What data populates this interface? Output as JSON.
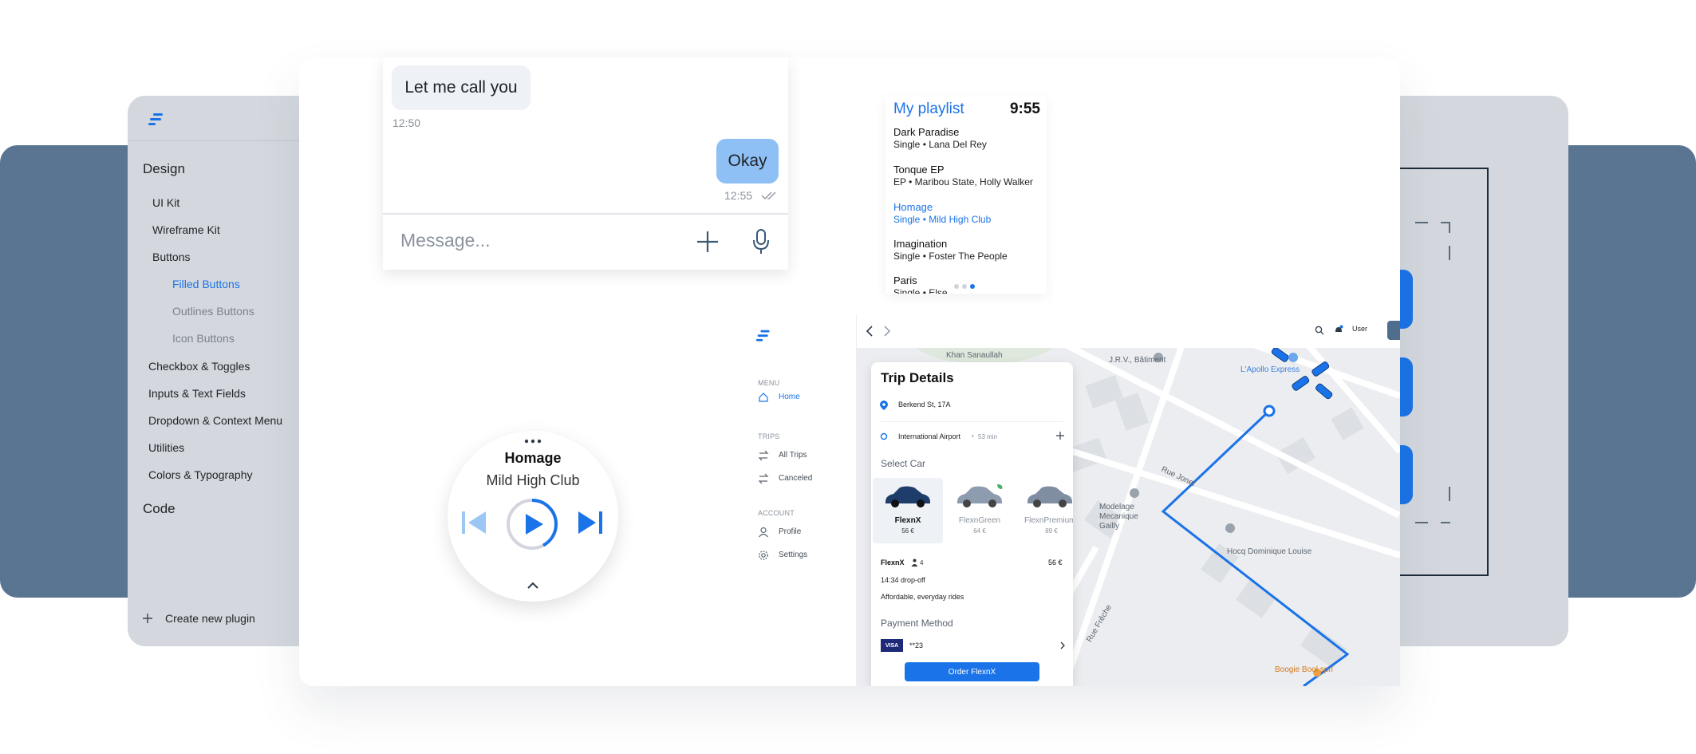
{
  "colors": {
    "accent": "#1a73e8",
    "backdrop_dark": "#5a7592",
    "backdrop_light": "#d4d8de",
    "bubble_outgoing": "#8ec0f5",
    "bubble_incoming": "#eef1f5"
  },
  "sidebar": {
    "sections": [
      {
        "label": "Design"
      },
      {
        "label": "Code"
      }
    ],
    "items": [
      {
        "label": "UI Kit"
      },
      {
        "label": "Wireframe Kit"
      },
      {
        "label": "Buttons"
      },
      {
        "label": "Filled Buttons",
        "active": true
      },
      {
        "label": "Outlines Buttons"
      },
      {
        "label": "Icon Buttons"
      },
      {
        "label": "Checkbox & Toggles"
      },
      {
        "label": "Inputs & Text Fields"
      },
      {
        "label": "Dropdown & Context Menu"
      },
      {
        "label": "Utilities"
      },
      {
        "label": "Colors & Typography"
      }
    ],
    "create_plugin": "Create new plugin"
  },
  "chat": {
    "incoming": {
      "text": "Let me call you",
      "time": "12:50"
    },
    "outgoing": {
      "text": "Okay",
      "time": "12:55"
    },
    "input_placeholder": "Message..."
  },
  "playlist": {
    "title": "My playlist",
    "clock": "9:55",
    "tracks": [
      {
        "name": "Dark Paradise",
        "meta": "Single • Lana Del Rey"
      },
      {
        "name": "Tonque EP",
        "meta": "EP • Maribou State, Holly Walker"
      },
      {
        "name": "Homage",
        "meta": "Single • Mild High Club",
        "highlighted": true
      },
      {
        "name": "Imagination",
        "meta": "Single • Foster The People"
      },
      {
        "name": "Paris",
        "meta": "Single • Else"
      }
    ],
    "page_dots": 3,
    "current_page": 3
  },
  "player": {
    "title": "Homage",
    "artist": "Mild High Club"
  },
  "trip_app": {
    "menu_label": "MENU",
    "home": "Home",
    "trips_label": "TRIPS",
    "all_trips": "All Trips",
    "canceled": "Canceled",
    "account_label": "ACCOUNT",
    "profile": "Profile",
    "settings": "Settings",
    "user": "User",
    "panel": {
      "title": "Trip Details",
      "pickup": "Berkend St, 17A",
      "destination": "International Airport",
      "eta": "53 min",
      "select_car": "Select Car",
      "cars": [
        {
          "name": "FlexnX",
          "price": "56 €",
          "selected": true
        },
        {
          "name": "FlexnGreen",
          "price": "64 €"
        },
        {
          "name": "FlexnPremium",
          "price": "89 €"
        }
      ],
      "selected_name": "FlexnX",
      "seats": "4",
      "selected_price": "56 €",
      "dropoff": "14:34 drop-off",
      "description": "Affordable, everyday rides",
      "payment_label": "Payment Method",
      "card_brand": "VISA",
      "card_number": "**23",
      "order_button": "Order FlexnX"
    },
    "map_labels": [
      "Khan Sanaullah",
      "J.R.V., Bâtiment",
      "L'Apollo Express",
      "Rue Jonet",
      "Modelage Mecanique Gailly",
      "Hocq Dominique Louise",
      "Rue Frêche",
      "Boogie Bool sprl"
    ]
  }
}
